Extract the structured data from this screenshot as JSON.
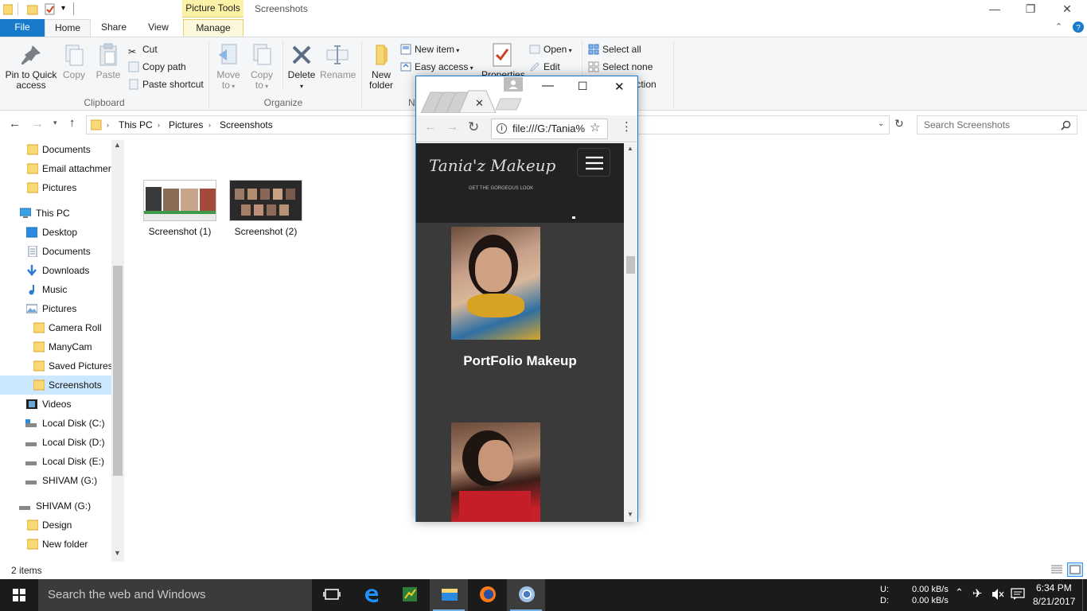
{
  "window": {
    "title": "Screenshots",
    "context_tab": "Picture Tools",
    "minimize": "—",
    "restore": "❐",
    "close": "✕"
  },
  "ribbon_tabs": {
    "file": "File",
    "home": "Home",
    "share": "Share",
    "view": "View",
    "manage": "Manage"
  },
  "ribbon": {
    "clipboard": {
      "pin_line1": "Pin to Quick",
      "pin_line2": "access",
      "copy": "Copy",
      "paste": "Paste",
      "cut": "Cut",
      "copy_path": "Copy path",
      "paste_shortcut": "Paste shortcut",
      "group": "Clipboard"
    },
    "organize": {
      "move_line1": "Move",
      "move_line2": "to",
      "copy_line1": "Copy",
      "copy_line2": "to",
      "delete": "Delete",
      "rename": "Rename",
      "group": "Organize"
    },
    "new": {
      "new_folder_line1": "New",
      "new_folder_line2": "folder",
      "new_item": "New item",
      "easy_access": "Easy access",
      "group": "N"
    },
    "open": {
      "properties": "Properties",
      "open": "Open",
      "edit": "Edit"
    },
    "select": {
      "select_all": "Select all",
      "select_none": "Select none",
      "invert_selection": "lection"
    }
  },
  "address": {
    "crumbs": [
      "This PC",
      "Pictures",
      "Screenshots"
    ],
    "search_placeholder": "Search Screenshots"
  },
  "nav": {
    "items": [
      {
        "label": "Documents",
        "icon": "folder-icon"
      },
      {
        "label": "Email attachmer",
        "icon": "folder-icon"
      },
      {
        "label": "Pictures",
        "icon": "folder-icon"
      },
      {
        "label": "This PC",
        "icon": "computer-icon"
      },
      {
        "label": "Desktop",
        "icon": "desktop-icon"
      },
      {
        "label": "Documents",
        "icon": "documents-icon"
      },
      {
        "label": "Downloads",
        "icon": "download-icon"
      },
      {
        "label": "Music",
        "icon": "music-icon"
      },
      {
        "label": "Pictures",
        "icon": "pictures-icon"
      },
      {
        "label": "Camera Roll",
        "icon": "folder-icon"
      },
      {
        "label": "ManyCam",
        "icon": "folder-icon"
      },
      {
        "label": "Saved Pictures",
        "icon": "folder-icon"
      },
      {
        "label": "Screenshots",
        "icon": "folder-icon"
      },
      {
        "label": "Videos",
        "icon": "video-icon"
      },
      {
        "label": "Local Disk (C:)",
        "icon": "drive-icon"
      },
      {
        "label": "Local Disk (D:)",
        "icon": "drive-icon"
      },
      {
        "label": "Local Disk (E:)",
        "icon": "drive-icon"
      },
      {
        "label": "SHIVAM (G:)",
        "icon": "drive-icon"
      },
      {
        "label": "SHIVAM (G:)",
        "icon": "drive-icon"
      },
      {
        "label": "Design",
        "icon": "folder-icon"
      },
      {
        "label": "New folder",
        "icon": "folder-icon"
      }
    ]
  },
  "files": [
    {
      "name": "Screenshot (1)"
    },
    {
      "name": "Screenshot (2)"
    }
  ],
  "status": {
    "items": "2 items"
  },
  "chrome": {
    "url": "file:///G:/Tania%",
    "logo_main": "Tania'z Makeup",
    "logo_sub": "GET THE GORGEOUS LOOK",
    "portfolio_title": "PortFolio Makeup"
  },
  "taskbar": {
    "search": "Search the web and Windows",
    "net_up_label": "U:",
    "net_down_label": "D:",
    "net_up": "0.00 kB/s",
    "net_down": "0.00 kB/s",
    "time": "6:34 PM",
    "date": "8/21/2017"
  },
  "colors": {
    "accent": "#1979ca",
    "context_tab": "#fbf1a7",
    "taskbar": "#1b1b1b",
    "selection": "#cce8ff"
  }
}
